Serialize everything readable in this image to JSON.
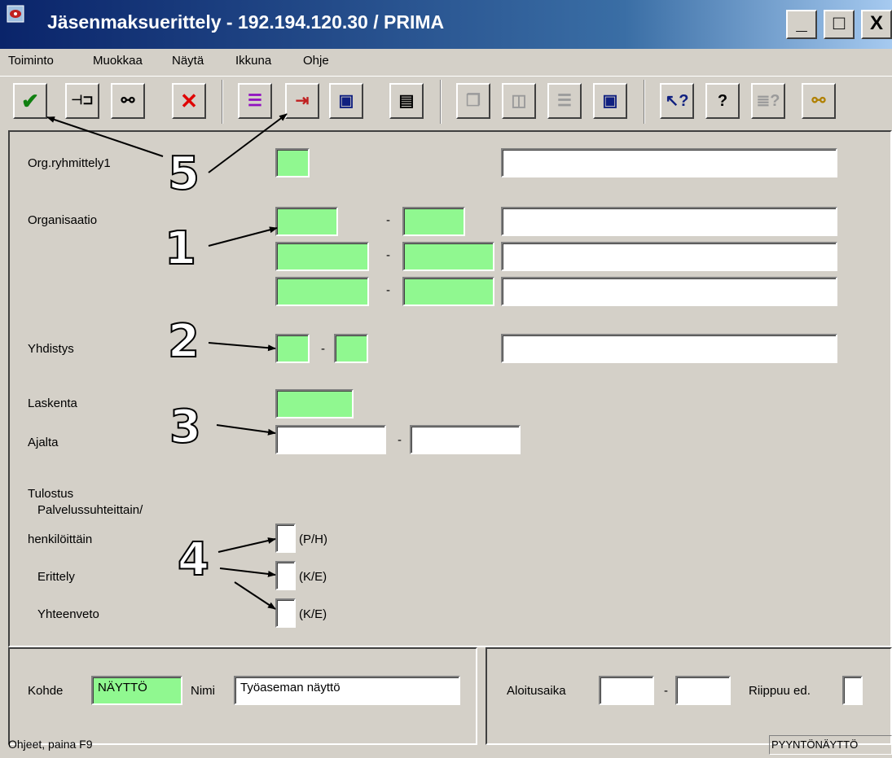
{
  "window": {
    "title": "Jäsenmaksuerittely - 192.194.120.30 / PRIMA",
    "minimize_label": "_",
    "maximize_label": "□",
    "close_label": "X"
  },
  "menu": [
    "Toiminto",
    "Muokkaa",
    "Näytä",
    "Ikkuna",
    "Ohje"
  ],
  "form": {
    "org_ryhmittely_label": "Org.ryhmittely1",
    "organisaatio_label": "Organisaatio",
    "yhdistys_label": "Yhdistys",
    "laskenta_label": "Laskenta",
    "ajalta_label": "Ajalta",
    "dash": "-",
    "tulostus_label": "Tulostus",
    "palvelus_label_1": "Palvelussuhteittain/",
    "palvelus_label_2": "henkilöittäin",
    "palvelus_hint": "(P/H)",
    "erittely_label": "Erittely",
    "erittely_hint": "(K/E)",
    "yhteenveto_label": "Yhteenveto",
    "yhteenveto_hint": "(K/E)"
  },
  "annotations": [
    "1",
    "2",
    "3",
    "4",
    "5"
  ],
  "bottom": {
    "kohde_label": "Kohde",
    "kohde_value": "NÄYTTÖ",
    "nimi_label": "Nimi",
    "nimi_value": "Työaseman näyttö",
    "aloitusaika_label": "Aloitusaika",
    "riippuu_label": "Riippuu ed."
  },
  "status": {
    "help_text": "Ohjeet, paina F9",
    "mode_text": "PYYNTÖNÄYTTÖ"
  },
  "colors": {
    "required_field": "#90f890",
    "face": "#d4d0c8",
    "title_start": "#0a246a"
  }
}
